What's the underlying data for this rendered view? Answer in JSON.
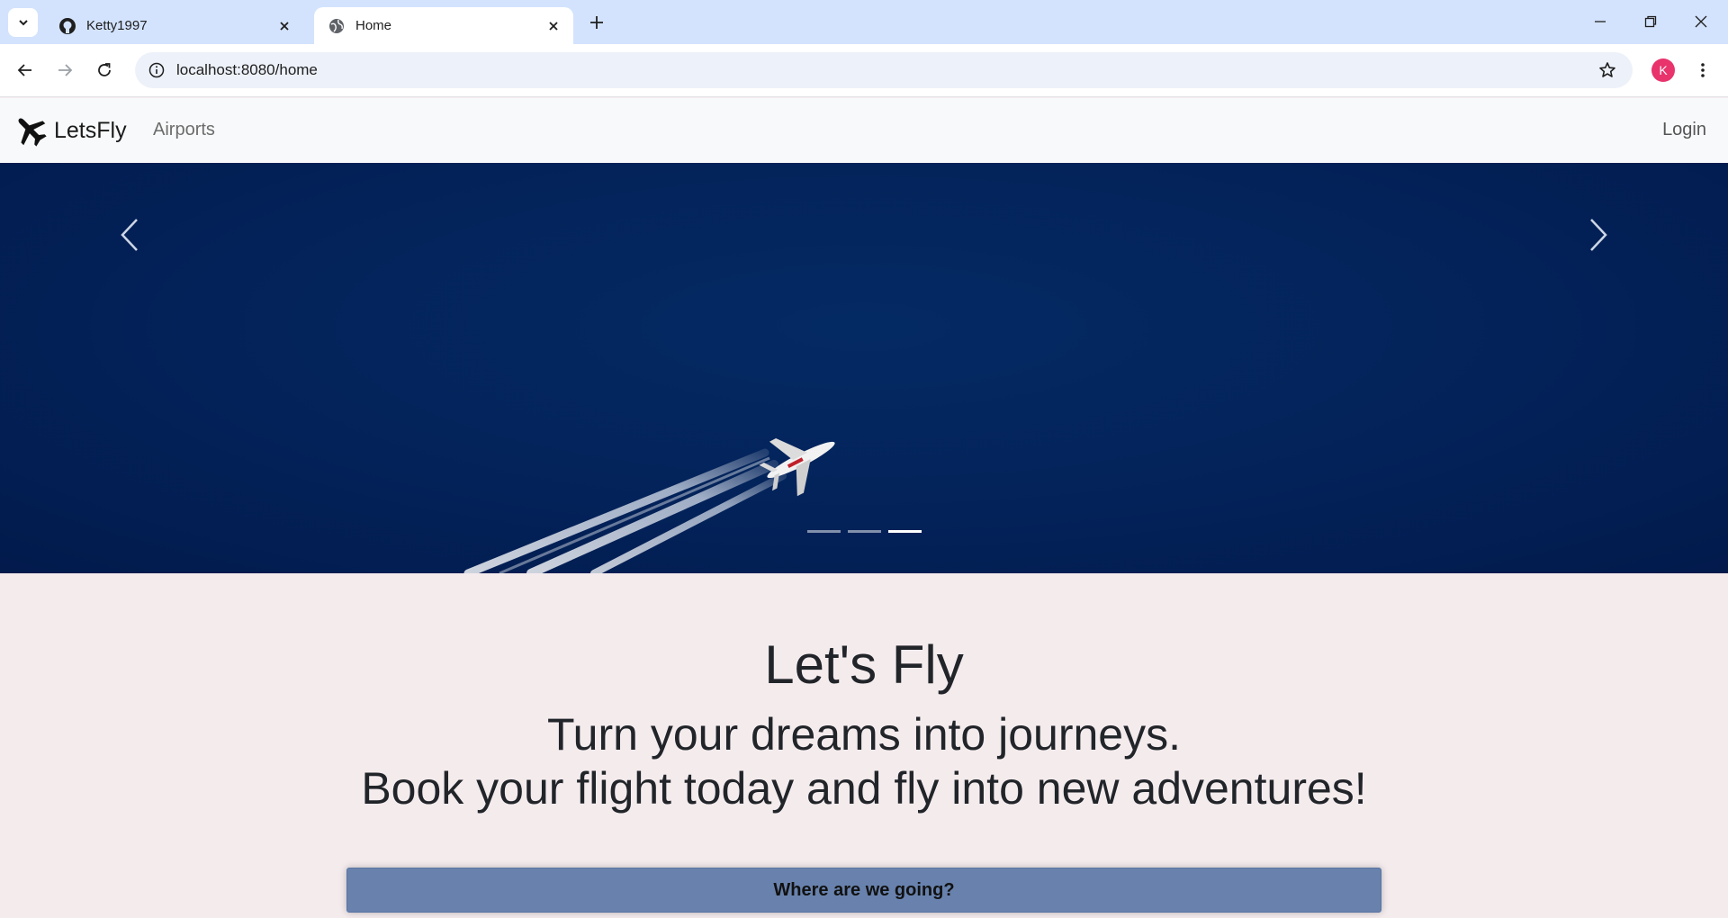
{
  "browser": {
    "tabs": [
      {
        "title": "Ketty1997",
        "icon": "github-icon",
        "active": false
      },
      {
        "title": "Home",
        "icon": "globe-icon",
        "active": true
      }
    ],
    "url": "localhost:8080/home",
    "profile_initial": "K",
    "profile_color": "#e8336d"
  },
  "navbar": {
    "brand": "LetsFly",
    "links": [
      {
        "label": "Airports"
      }
    ],
    "login_label": "Login"
  },
  "carousel": {
    "slide_count": 3,
    "active_index": 2
  },
  "hero": {
    "title": "Let's Fly",
    "tagline_1": "Turn your dreams into journeys.",
    "tagline_2": "Book your flight today and fly into new adventures!",
    "cta_label": "Where are we going?"
  },
  "colors": {
    "accent_button": "#6882ad",
    "hero_bg": "#f4ebed",
    "carousel_sky": "#032259"
  }
}
